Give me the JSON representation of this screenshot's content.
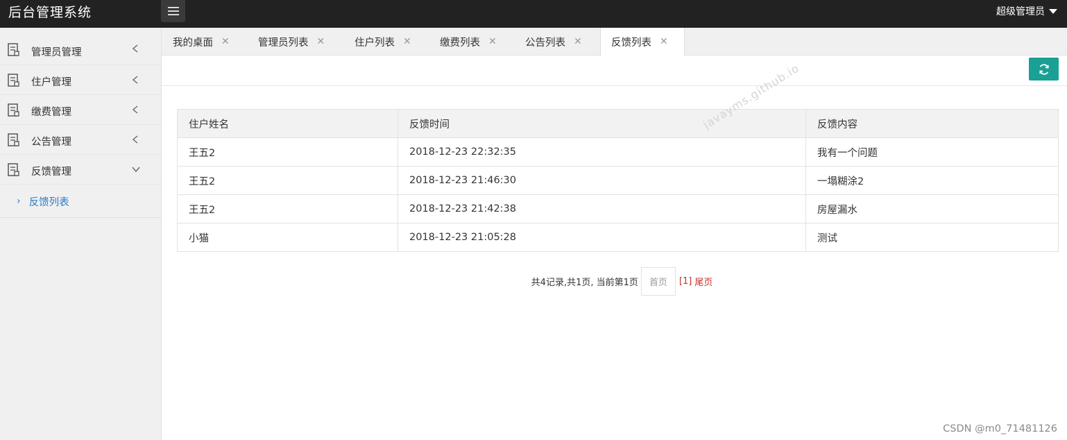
{
  "app": {
    "title": "后台管理系统",
    "user_label": "超级管理员"
  },
  "sidebar": {
    "items": [
      {
        "label": "管理员管理",
        "expanded": false
      },
      {
        "label": "住户管理",
        "expanded": false
      },
      {
        "label": "缴费管理",
        "expanded": false
      },
      {
        "label": "公告管理",
        "expanded": false
      },
      {
        "label": "反馈管理",
        "expanded": true
      }
    ],
    "subitems": [
      {
        "label": "反馈列表"
      }
    ]
  },
  "tabs": [
    {
      "label": "我的桌面",
      "active": false
    },
    {
      "label": "管理员列表",
      "active": false
    },
    {
      "label": "住户列表",
      "active": false
    },
    {
      "label": "缴费列表",
      "active": false
    },
    {
      "label": "公告列表",
      "active": false
    },
    {
      "label": "反馈列表",
      "active": true
    }
  ],
  "table": {
    "headers": [
      "住户姓名",
      "反馈时间",
      "反馈内容"
    ],
    "rows": [
      [
        "王五2",
        "2018-12-23 22:32:35",
        "我有一个问题"
      ],
      [
        "王五2",
        "2018-12-23 21:46:30",
        "一塌糊涂2"
      ],
      [
        "王五2",
        "2018-12-23 21:42:38",
        "房屋漏水"
      ],
      [
        "小猫",
        "2018-12-23 21:05:28",
        "测试"
      ]
    ]
  },
  "pager": {
    "info": "共4记录,共1页, 当前第1页",
    "first_label": "首页",
    "page_label": "[1]",
    "last_label": "尾页"
  },
  "watermark": "javayms.github.io",
  "credit": "CSDN @m0_71481126",
  "colors": {
    "topbar": "#222222",
    "sidebar": "#f0f0f0",
    "accent": "#1aa094",
    "link": "#2a7cc7",
    "pager_link": "#c9302c"
  },
  "icons": {
    "menu": "hamburger-icon",
    "nav": "document-icon",
    "collapsed": "chevron-left-icon",
    "expanded": "chevron-down-icon",
    "refresh": "refresh-icon",
    "close": "close-icon"
  }
}
